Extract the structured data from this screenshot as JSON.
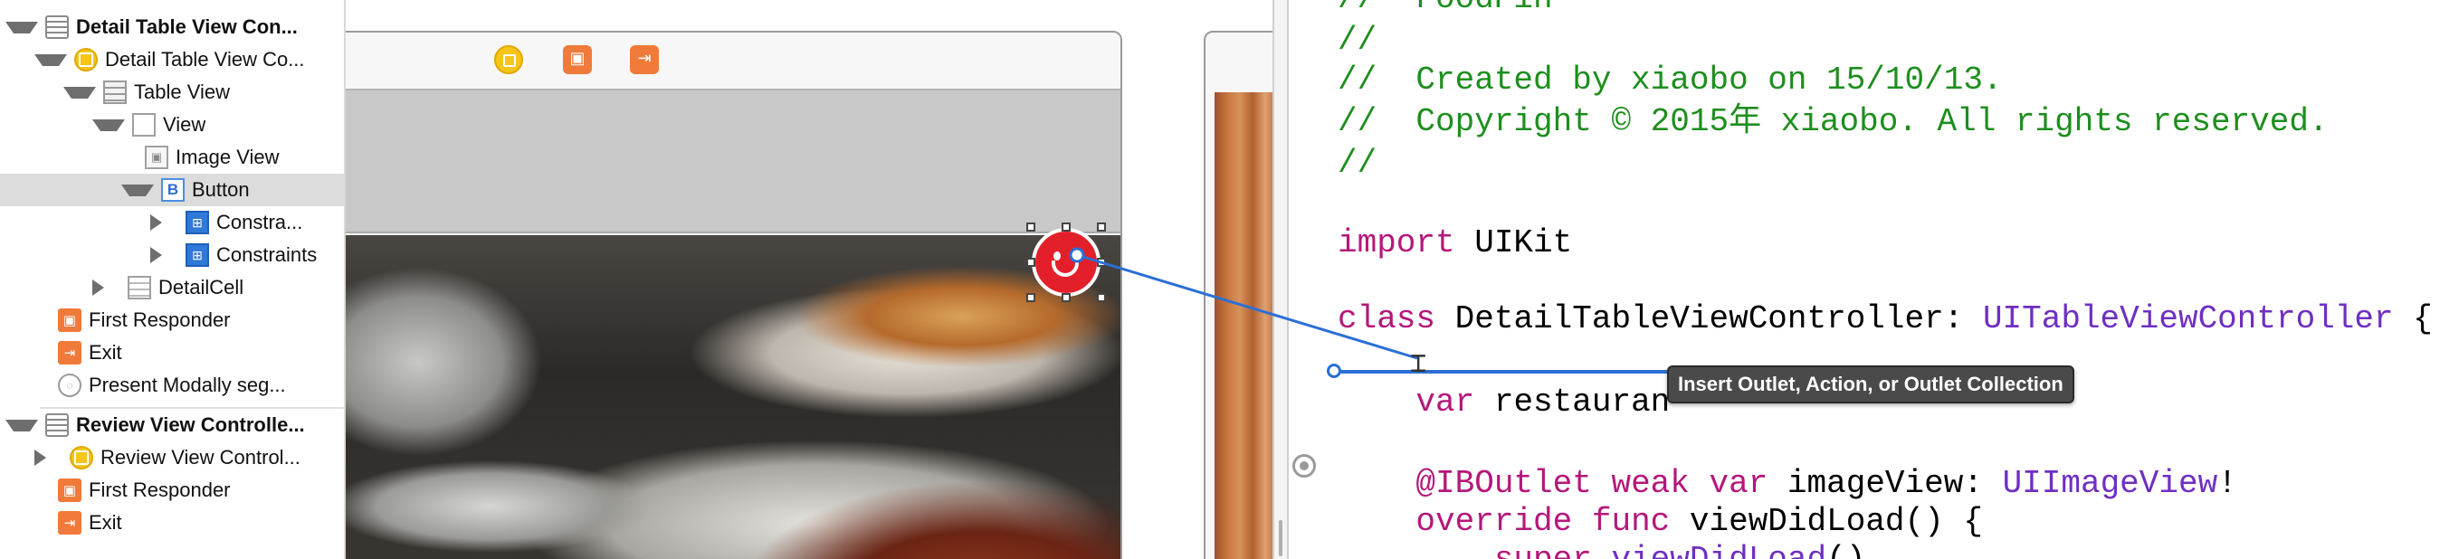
{
  "outline": {
    "items": [
      {
        "label": "Detail Table View Con...",
        "icon": "storyboard-scene-icon",
        "disclosure": "down",
        "bold": true
      },
      {
        "label": "Detail Table View Co...",
        "icon": "view-controller-icon",
        "disclosure": "down",
        "bold": false
      },
      {
        "label": "Table View",
        "icon": "table-view-icon",
        "disclosure": "down",
        "bold": false
      },
      {
        "label": "View",
        "icon": "view-icon",
        "disclosure": "down",
        "bold": false
      },
      {
        "label": "Image View",
        "icon": "image-view-icon",
        "disclosure": "none",
        "bold": false
      },
      {
        "label": "Button",
        "icon": "button-icon",
        "disclosure": "down",
        "bold": false,
        "selected": true
      },
      {
        "label": "Constra...",
        "icon": "constraints-icon",
        "disclosure": "right",
        "bold": false
      },
      {
        "label": "Constraints",
        "icon": "constraints-icon",
        "disclosure": "right",
        "bold": false
      },
      {
        "label": "DetailCell",
        "icon": "table-cell-icon",
        "disclosure": "right",
        "bold": false
      },
      {
        "label": "First Responder",
        "icon": "first-responder-icon",
        "disclosure": "none",
        "bold": false
      },
      {
        "label": "Exit",
        "icon": "exit-icon",
        "disclosure": "none",
        "bold": false
      },
      {
        "label": "Present Modally seg...",
        "icon": "segue-icon",
        "disclosure": "none",
        "bold": false
      },
      {
        "label": "Review View Controlle...",
        "icon": "storyboard-scene-icon",
        "disclosure": "down",
        "bold": true
      },
      {
        "label": "Review View Control...",
        "icon": "view-controller-icon",
        "disclosure": "right",
        "bold": false
      },
      {
        "label": "First Responder",
        "icon": "first-responder-icon",
        "disclosure": "none",
        "bold": false
      },
      {
        "label": "Exit",
        "icon": "exit-icon",
        "disclosure": "none",
        "bold": false
      }
    ]
  },
  "canvas": {
    "dock_icons": [
      "view-controller-icon",
      "first-responder-icon",
      "exit-icon"
    ]
  },
  "editor": {
    "lines": [
      [
        {
          "t": "//  FoodPin",
          "c": "comment"
        }
      ],
      [
        {
          "t": "//",
          "c": "comment"
        }
      ],
      [
        {
          "t": "//  Created by xiaobo on 15/10/13.",
          "c": "comment"
        }
      ],
      [
        {
          "t": "//  Copyright © 2015年 xiaobo. All rights reserved.",
          "c": "comment"
        }
      ],
      [
        {
          "t": "//",
          "c": "comment"
        }
      ],
      [
        {
          "t": "",
          "c": "plain"
        }
      ],
      [
        {
          "t": "import",
          "c": "kw"
        },
        {
          "t": " UIKit",
          "c": "plain"
        }
      ],
      [
        {
          "t": "",
          "c": "plain"
        }
      ],
      [
        {
          "t": "class",
          "c": "kw"
        },
        {
          "t": " DetailTableViewController: ",
          "c": "plain"
        },
        {
          "t": "UITableViewController",
          "c": "type"
        },
        {
          "t": " {",
          "c": "plain"
        }
      ],
      [
        {
          "t": "",
          "c": "plain"
        }
      ],
      [
        {
          "t": "    ",
          "c": "plain"
        },
        {
          "t": "var",
          "c": "kw"
        },
        {
          "t": " restauran",
          "c": "plain"
        }
      ],
      [
        {
          "t": "",
          "c": "plain"
        }
      ],
      [
        {
          "t": "    ",
          "c": "plain"
        },
        {
          "t": "@IBOutlet",
          "c": "kw"
        },
        {
          "t": " ",
          "c": "plain"
        },
        {
          "t": "weak",
          "c": "kw"
        },
        {
          "t": " ",
          "c": "plain"
        },
        {
          "t": "var",
          "c": "kw"
        },
        {
          "t": " imageView: ",
          "c": "plain"
        },
        {
          "t": "UIImageView",
          "c": "type"
        },
        {
          "t": "!",
          "c": "plain"
        }
      ],
      [
        {
          "t": "    ",
          "c": "plain"
        },
        {
          "t": "override",
          "c": "kw"
        },
        {
          "t": " ",
          "c": "plain"
        },
        {
          "t": "func",
          "c": "kw"
        },
        {
          "t": " viewDidLoad() {",
          "c": "plain"
        }
      ],
      [
        {
          "t": "        ",
          "c": "plain"
        },
        {
          "t": "super",
          "c": "kw"
        },
        {
          "t": ".",
          "c": "plain"
        },
        {
          "t": "viewDidLoad",
          "c": "type"
        },
        {
          "t": "()",
          "c": "plain"
        }
      ]
    ]
  },
  "tooltip": {
    "text": "Insert Outlet, Action, or Outlet Collection"
  },
  "colors": {
    "comment": "#1e8e1e",
    "keyword": "#b5177b",
    "type": "#6f2fc2",
    "connection": "#2b6fd6",
    "button_red": "#e3202a"
  }
}
